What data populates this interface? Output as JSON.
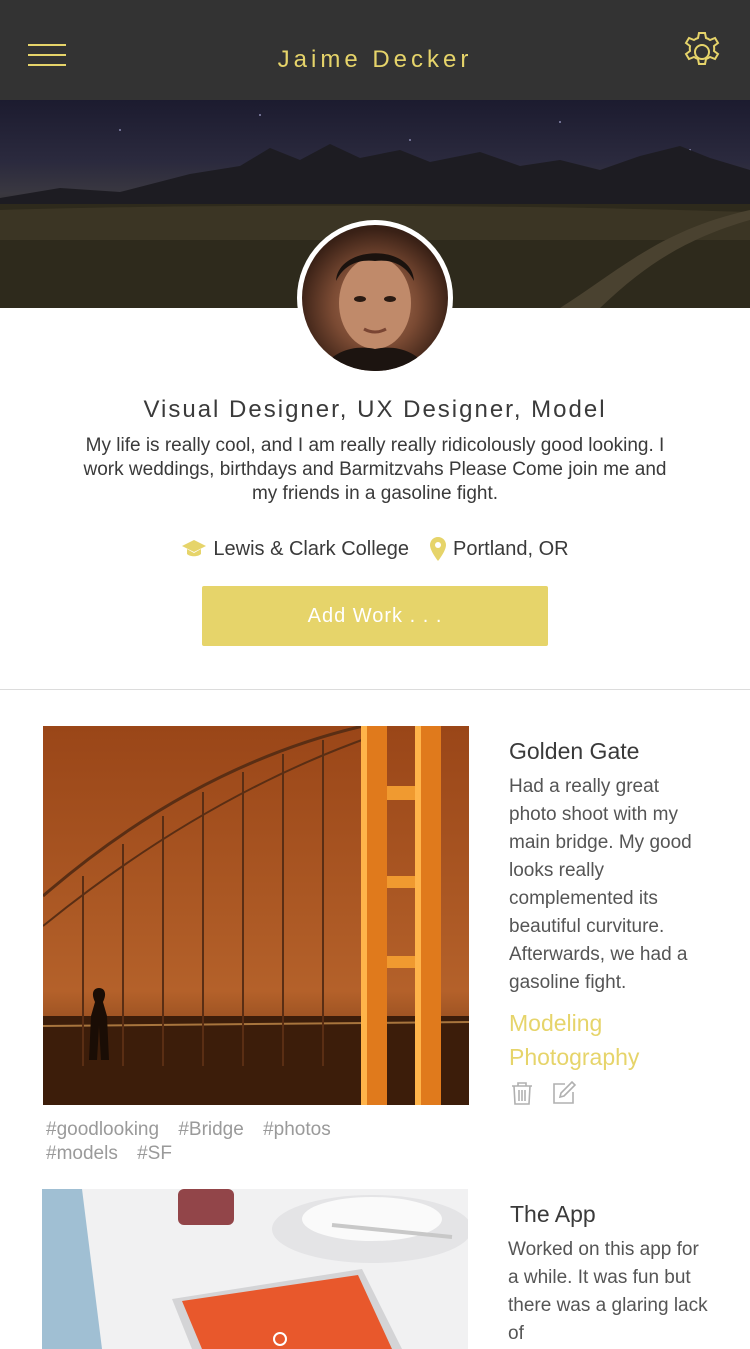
{
  "header": {
    "title": "Jaime Decker",
    "accent_color": "#e6d46a",
    "background_color": "#333333",
    "menu_icon": "hamburger-icon",
    "settings_icon": "gear-icon"
  },
  "profile": {
    "cover_image": "night-landscape-photo",
    "avatar_image": "profile-portrait-photo",
    "role": "Visual Designer, UX Designer, Model",
    "bio": "My life is really cool, and I am really really ridicolously good looking. I work weddings, birthdays and Barmitzvahs Please Come join me and my friends in a gasoline fight.",
    "school": {
      "icon": "graduation-cap-icon",
      "label": "Lewis & Clark College"
    },
    "location": {
      "icon": "map-pin-icon",
      "label": "Portland, OR"
    },
    "add_work_label": "Add Work . . ."
  },
  "works": [
    {
      "title": "Golden Gate",
      "image": "golden-gate-bridge-photo",
      "description": "Had a really great photo shoot with my main bridge. My good looks really complemented its beautiful curviture. Afterwards, we had a gasoline fight.",
      "category_line1": "Modeling",
      "category_line2": "Photography",
      "tags": [
        "#goodlooking",
        "#Bridge",
        "#photos",
        "#models",
        "#SF"
      ],
      "actions": [
        "trash-icon",
        "edit-icon"
      ]
    },
    {
      "title": "The App",
      "image": "phone-app-photo",
      "description": "Worked on this app for a while. It was fun but there was a glaring lack of"
    }
  ]
}
